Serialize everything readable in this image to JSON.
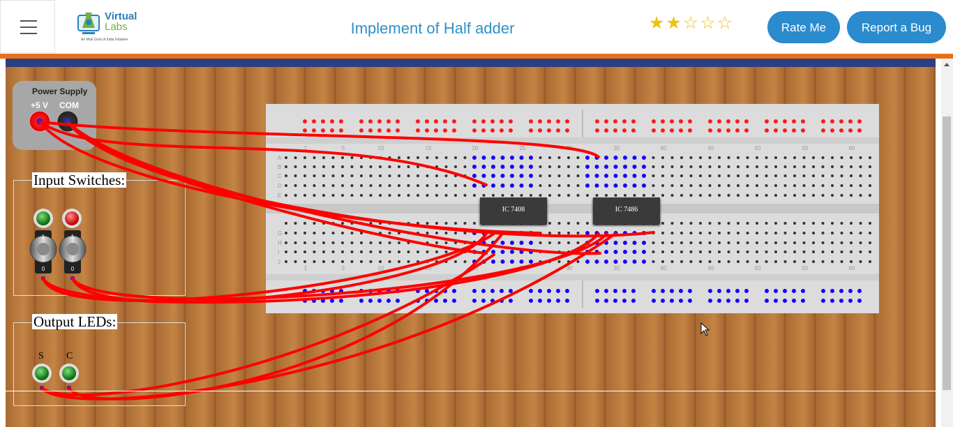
{
  "header": {
    "menu_icon": "hamburger-menu-icon",
    "logo": {
      "line1": "Virtual",
      "line2": "Labs",
      "tagline": "An MoE Govt of India Initiative"
    },
    "title": "Implement of Half adder",
    "rating": {
      "value": 2,
      "max": 5
    },
    "rate_button": "Rate Me",
    "bug_button": "Report a Bug"
  },
  "colors": {
    "accent": "#2a8bcd",
    "title": "#2f8fc9",
    "orange_bar": "#e8701a",
    "navy_bar": "#2c3f80",
    "wire": "#ff0000",
    "live_hole": "#1500ff"
  },
  "power_supply": {
    "title": "Power Supply",
    "plus_label": "+5 V",
    "com_label": "COM"
  },
  "input_switches": {
    "title": "Input Switches:",
    "switch_top": "1",
    "switch_bottom": "0",
    "count": 2
  },
  "output_leds": {
    "title": "Output LEDs:",
    "leds": [
      "S",
      "C"
    ]
  },
  "breadboard": {
    "column_numbers": [
      "1",
      "5",
      "10",
      "15",
      "20",
      "25",
      "30",
      "35",
      "40",
      "45",
      "50",
      "55",
      "60"
    ],
    "top_rows": [
      "A",
      "B",
      "C",
      "D",
      "E"
    ],
    "bottom_rows": [
      "G",
      "H",
      "I",
      "J"
    ],
    "ics": [
      {
        "label": "IC 7408"
      },
      {
        "label": "IC 7486"
      }
    ]
  }
}
